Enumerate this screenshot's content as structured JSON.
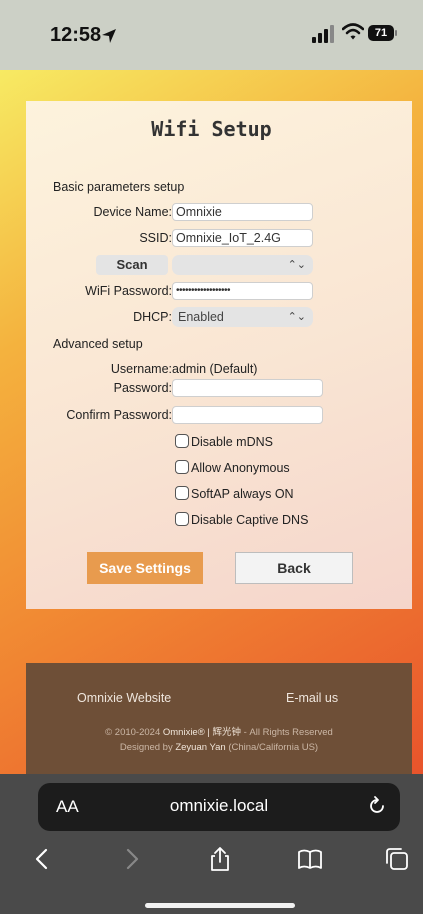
{
  "status_bar": {
    "time": "12:58",
    "battery": "71"
  },
  "page": {
    "title": "Wifi Setup",
    "basic_heading": "Basic parameters setup",
    "device_name_label": "Device Name:",
    "device_name_value": "Omnixie",
    "ssid_label": "SSID:",
    "ssid_value": "Omnixie_IoT_2.4G",
    "scan_button": "Scan",
    "wifi_password_label": "WiFi Password:",
    "wifi_password_value": "••••••••••••••••••",
    "dhcp_label": "DHCP:",
    "dhcp_value": "Enabled",
    "advanced_heading": "Advanced setup",
    "username_label": "Username:",
    "username_value": "admin (Default)",
    "password_label": "Password:",
    "confirm_password_label": "Confirm Password:",
    "checkboxes": [
      {
        "label": "Disable mDNS",
        "checked": false
      },
      {
        "label": "Allow Anonymous",
        "checked": false
      },
      {
        "label": "SoftAP always ON",
        "checked": false
      },
      {
        "label": "Disable Captive DNS",
        "checked": false
      }
    ],
    "save_button": "Save Settings",
    "back_button": "Back"
  },
  "footer": {
    "website_link": "Omnixie Website",
    "email_link": "E-mail us",
    "copyright_prefix": "© 2010-2024",
    "copyright_brand": "Omnixie® | 辉光钟",
    "copyright_suffix": "- All Rights Reserved",
    "designed_prefix": "Designed by",
    "designer": "Zeyuan Yan",
    "designer_location": "(China/California US)"
  },
  "browser": {
    "aa": "AA",
    "url": "omnixie.local"
  },
  "colors": {
    "save_button": "#e89b4e",
    "footer_bg": "#6e4f37"
  }
}
